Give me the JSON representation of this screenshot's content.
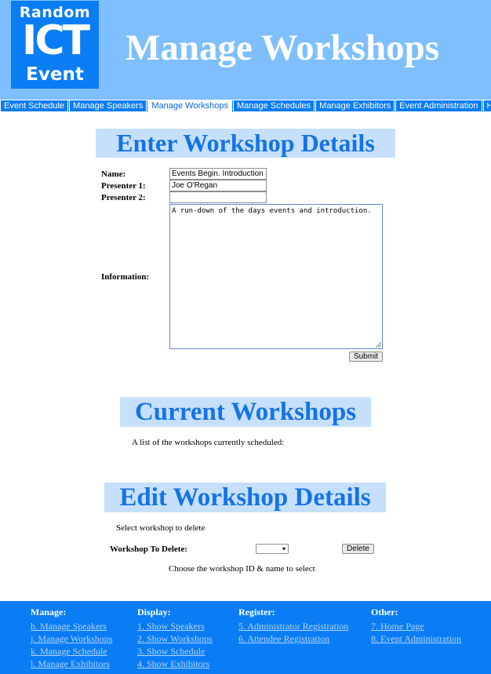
{
  "logo": {
    "line1": "Random",
    "line2": "ICT",
    "line3": "Event"
  },
  "header": {
    "title": "Manage Workshops"
  },
  "nav": [
    {
      "label": "Event Schedule",
      "active": false
    },
    {
      "label": "Manage Speakers",
      "active": false
    },
    {
      "label": "Manage Workshops",
      "active": true
    },
    {
      "label": "Manage Schedules",
      "active": false
    },
    {
      "label": "Manage Exhibitors",
      "active": false
    },
    {
      "label": "Event Administration",
      "active": false
    },
    {
      "label": "Home",
      "active": false
    }
  ],
  "enter": {
    "heading": "Enter Workshop Details",
    "name_label": "Name:",
    "name_value": "Events Begin. Introduction",
    "presenter1_label": "Presenter 1:",
    "presenter1_value": "Joe O'Regan",
    "presenter2_label": "Presenter 2:",
    "presenter2_value": "",
    "info_label": "Information:",
    "info_value": "A run-down of the days events and introduction.",
    "submit_label": "Submit"
  },
  "current": {
    "heading": "Current Workshops",
    "description": "A list of the workshops currently scheduled:"
  },
  "edit": {
    "heading": "Edit Workshop Details",
    "instruction": "Select workshop to delete",
    "delete_label": "Workshop To Delete:",
    "select_value": "",
    "delete_button": "Delete",
    "hint": "Choose the workshop ID & name to select"
  },
  "footer": {
    "manage": {
      "heading": "Manage:",
      "links": [
        "h. Manage Speakers",
        "j. Manage Workshops",
        "k. Manage Schedule",
        "l. Manage Exhibitors"
      ]
    },
    "display": {
      "heading": "Display:",
      "links": [
        "1. Show Speakers",
        "2. Show Workshops",
        "3. Show Schedule",
        "4. Show Exhibitors"
      ]
    },
    "register": {
      "heading": "Register:",
      "links": [
        "5. Administrator Registration",
        "6. Attendee Registration"
      ]
    },
    "other": {
      "heading": "Other:",
      "links": [
        "7. Home Page",
        "8. Event Administration"
      ]
    }
  },
  "colors": {
    "header_bg": "#7fbfff",
    "nav_bg": "#0a7df5",
    "heading_text": "#1473e6",
    "heading_bg": "#c6e0fb",
    "footer_bg": "#0a7df5",
    "footer_link": "#b2d3f7"
  }
}
